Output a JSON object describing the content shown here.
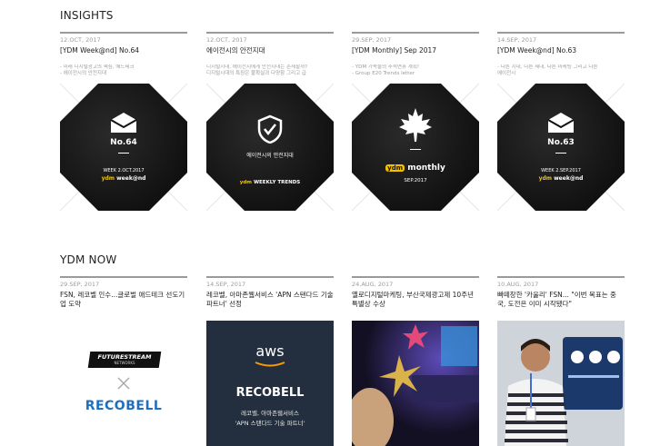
{
  "sections": {
    "insights": "INSIGHTS",
    "now": "YDM NOW"
  },
  "insights": [
    {
      "date": "12.OCT, 2017",
      "title": "[YDM Week@nd] No.64",
      "desc1": "- 미래 디지털광고의 핵심, 애드테크",
      "desc2": "- 에이전시의 안전지대",
      "thumb": {
        "number": "No.64",
        "sub1": "WEEK 2.OCT.2017",
        "brand": "week@nd",
        "icon": "mail-icon"
      }
    },
    {
      "date": "12.OCT, 2017",
      "title": "에이전시의 안전지대",
      "desc1": "디지털시대, 에이전시에게 안전지대는 존재할까?",
      "desc2": "디지털시대의 특징은 불확실과 다양함 그리고 급",
      "thumb": {
        "caption": "에이전시의 안전지대",
        "brand": "WEEKLY TRENDS",
        "icon": "shield-check-icon"
      }
    },
    {
      "date": "29.SEP, 2017",
      "title": "[YDM Monthly] Sep 2017",
      "desc1": "- YDM 가족들의 추석연휴 계획!",
      "desc2": "- Group E20 Trends letter",
      "thumb": {
        "brand": "monthly",
        "sub1": "SEP.2017",
        "icon": "maple-leaf-icon"
      }
    },
    {
      "date": "14.SEP, 2017",
      "title": "[YDM Week@nd] No.63",
      "desc1": "- 다른 시대, 다른 세대, 다른 마케팅 그리고 다른",
      "desc2": "에이전시",
      "thumb": {
        "number": "No.63",
        "sub1": "WEEK 2.SEP.2017",
        "brand": "week@nd",
        "icon": "mail-icon"
      }
    }
  ],
  "news": [
    {
      "date": "29.SEP, 2017",
      "title": "FSN, 레코벨 인수...글로벌 애드테크 선도기업 도약",
      "img": {
        "logo1": "FUTURESTREAM",
        "logo1sub": "NETWORKS",
        "logo2": "RECOBELL"
      }
    },
    {
      "date": "14.SEP, 2017",
      "title": "레코벨, 아마존웹서비스 'APN 스탠다드 기술 파트너' 선정",
      "img": {
        "aws": "aws",
        "brand": "RECOBELL",
        "line1": "레코벨, 아마존웹서비스",
        "line2": "'APN 스탠다드 기술 파트너'"
      }
    },
    {
      "date": "24.AUG, 2017",
      "title": "옐로디지털마케팅, 부산국제광고제 10주년 특별상 수상",
      "img": {}
    },
    {
      "date": "10.AUG, 2017",
      "title": "빠떼창한 '카울리' FSN... \"이번 목표는 중국, 도전은 이미 시작됐다\"",
      "img": {}
    }
  ],
  "colors": {
    "rule": "#9a9a9a",
    "accent": "#f2c200",
    "dark": "#141414"
  }
}
